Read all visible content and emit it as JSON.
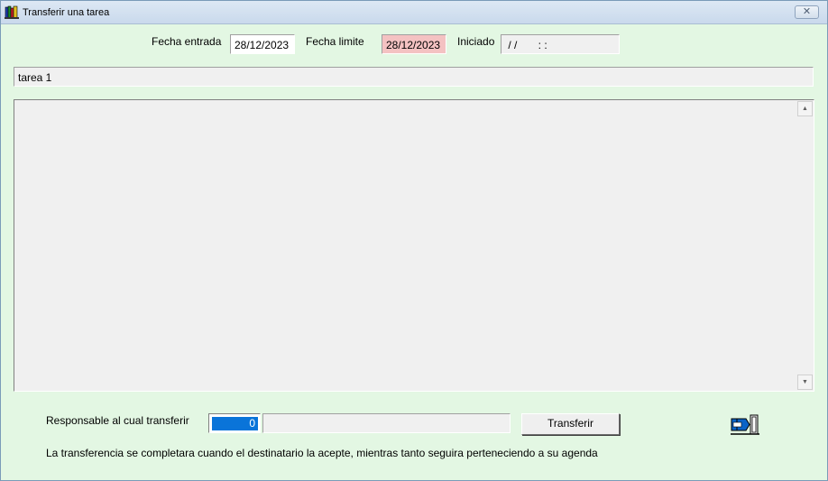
{
  "window": {
    "title": "Transferir una tarea",
    "close_label": "✕"
  },
  "dates": {
    "entrada_label": "Fecha entrada",
    "entrada_value": "28/12/2023",
    "limite_label": "Fecha limite",
    "limite_value": "28/12/2023",
    "iniciado_label": "Iniciado",
    "iniciado_value": " / /       : :"
  },
  "task": {
    "description": "tarea 1",
    "memo": ""
  },
  "transfer": {
    "responsable_label": "Responsable al cual transferir",
    "responsable_id": "0",
    "responsable_name": "",
    "button_label": "Transferir",
    "note": "La transferencia se completara cuando el destinatario la acepte, mientras tanto seguira perteneciendo a su agenda"
  },
  "icons": {
    "app": "books-icon",
    "exit": "exit-door-icon"
  },
  "colors": {
    "background": "#e3f7e3",
    "limite_field": "#f4c2c2",
    "selection": "#0a74d9"
  }
}
